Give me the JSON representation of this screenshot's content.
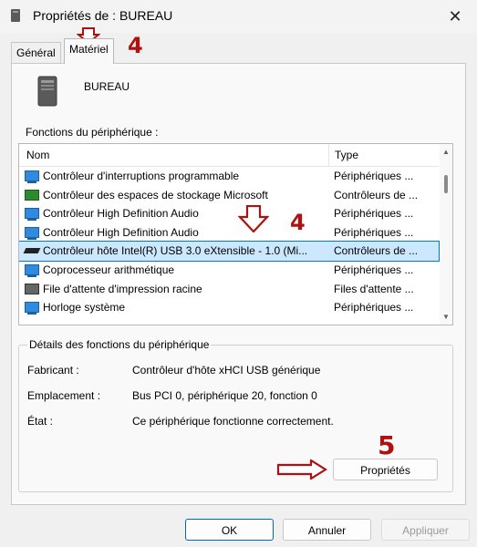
{
  "window": {
    "title": "Propriétés de : BUREAU",
    "close_glyph": "✕"
  },
  "tabs": [
    {
      "label": "Général",
      "active": false
    },
    {
      "label": "Matériel",
      "active": true
    }
  ],
  "device": {
    "name": "BUREAU",
    "icon": "computer-tower-icon"
  },
  "functions": {
    "label": "Fonctions du périphérique :",
    "columns": [
      "Nom",
      "Type"
    ],
    "rows": [
      {
        "name": "Contrôleur d'interruptions programmable",
        "type": "Périphériques ...",
        "icon": "system-device-icon"
      },
      {
        "name": "Contrôleur des espaces de stockage Microsoft",
        "type": "Contrôleurs de ...",
        "icon": "storage-controller-icon"
      },
      {
        "name": "Contrôleur High Definition Audio",
        "type": "Périphériques ...",
        "icon": "system-device-icon"
      },
      {
        "name": "Contrôleur High Definition Audio",
        "type": "Périphériques ...",
        "icon": "system-device-icon"
      },
      {
        "name": "Contrôleur hôte Intel(R) USB 3.0 eXtensible - 1.0 (Mi...",
        "type": "Contrôleurs de ...",
        "icon": "usb-controller-icon",
        "selected": true
      },
      {
        "name": "Coprocesseur arithmétique",
        "type": "Périphériques ...",
        "icon": "system-device-icon"
      },
      {
        "name": "File d'attente d'impression racine",
        "type": "Files d'attente ...",
        "icon": "print-queue-icon"
      },
      {
        "name": "Horloge système",
        "type": "Périphériques ...",
        "icon": "system-device-icon"
      }
    ]
  },
  "details": {
    "title": "Détails des fonctions du périphérique",
    "manufacturer_label": "Fabricant :",
    "manufacturer_value": "Contrôleur d'hôte xHCI USB générique",
    "location_label": "Emplacement :",
    "location_value": "Bus PCI 0, périphérique 20, fonction 0",
    "status_label": "État :",
    "status_value": "Ce périphérique fonctionne correctement.",
    "properties_button": "Propriétés"
  },
  "footer": {
    "ok": "OK",
    "cancel": "Annuler",
    "apply": "Appliquer"
  },
  "annotations": {
    "tab_step": "4",
    "row_step": "4",
    "button_step": "5",
    "color": "#b01010"
  }
}
